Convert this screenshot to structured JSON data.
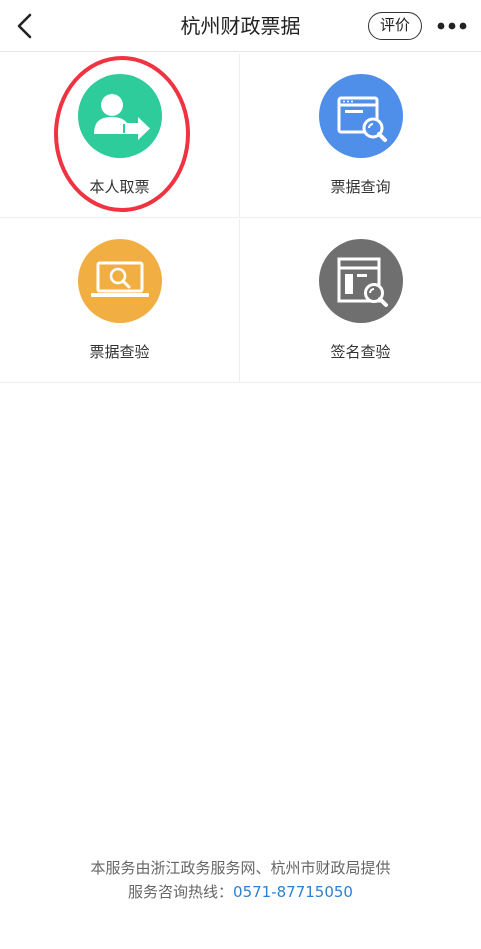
{
  "header": {
    "title": "杭州财政票据",
    "rate_label": "评价"
  },
  "grid": {
    "items": [
      {
        "label": "本人取票",
        "icon": "person-arrow-icon",
        "color": "#2ecb9b"
      },
      {
        "label": "票据查询",
        "icon": "browser-search-icon",
        "color": "#4f8fea"
      },
      {
        "label": "票据查验",
        "icon": "laptop-search-icon",
        "color": "#f1ae43"
      },
      {
        "label": "签名查验",
        "icon": "document-search-icon",
        "color": "#6f6f6f"
      }
    ]
  },
  "highlight": {
    "color": "#ef3340"
  },
  "footer": {
    "line1": "本服务由浙江政务服务网、杭州市财政局提供",
    "hotline_label": "服务咨询热线：",
    "hotline_number": "0571-87715050"
  }
}
